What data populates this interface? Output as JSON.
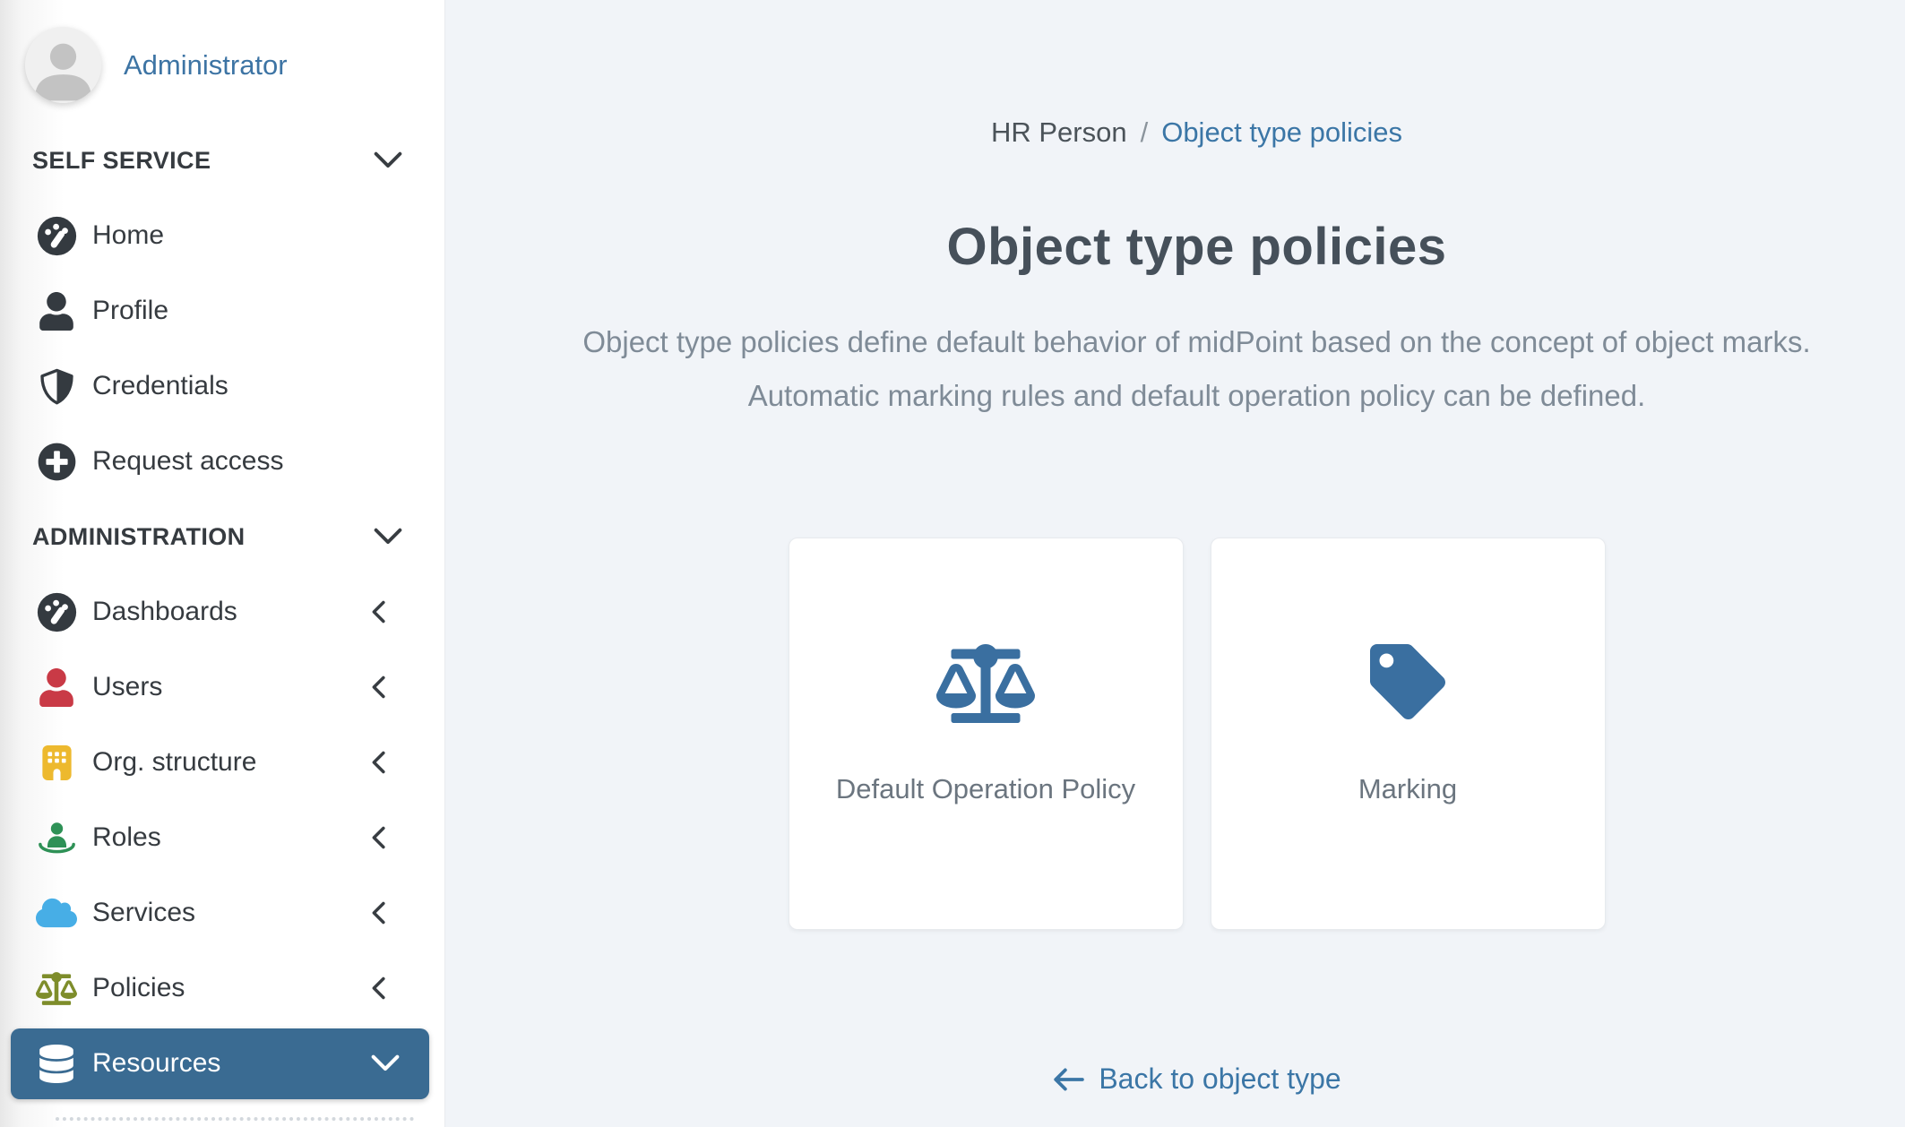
{
  "sidebar": {
    "user": {
      "name": "Administrator"
    },
    "sections": [
      {
        "label": "SELF SERVICE",
        "chevron": "down",
        "items": [
          {
            "label": "Home",
            "icon": "gauge-icon"
          },
          {
            "label": "Profile",
            "icon": "user-icon"
          },
          {
            "label": "Credentials",
            "icon": "shield-icon"
          },
          {
            "label": "Request access",
            "icon": "plus-circle-icon"
          }
        ]
      },
      {
        "label": "ADMINISTRATION",
        "chevron": "down",
        "items": [
          {
            "label": "Dashboards",
            "icon": "gauge-icon",
            "chevron": "left"
          },
          {
            "label": "Users",
            "icon": "user-icon",
            "chevron": "left"
          },
          {
            "label": "Org. structure",
            "icon": "building-icon",
            "chevron": "left"
          },
          {
            "label": "Roles",
            "icon": "person-ring-icon",
            "chevron": "left"
          },
          {
            "label": "Services",
            "icon": "cloud-icon",
            "chevron": "left"
          },
          {
            "label": "Policies",
            "icon": "balance-scale-icon",
            "chevron": "left"
          },
          {
            "label": "Resources",
            "icon": "database-icon",
            "chevron": "down",
            "selected": true
          }
        ]
      }
    ]
  },
  "main": {
    "breadcrumb": {
      "parent": "HR Person",
      "separator": "/",
      "current": "Object type policies"
    },
    "title": "Object type policies",
    "description": "Object type policies define default behavior of midPoint based on the concept of object marks. Automatic marking rules and default operation policy can be defined.",
    "cards": [
      {
        "label": "Default Operation Policy",
        "icon": "balance-scale-icon"
      },
      {
        "label": "Marking",
        "icon": "tag-icon"
      }
    ],
    "back_link": {
      "label": "Back to object type",
      "icon": "arrow-left-icon"
    }
  },
  "colors": {
    "accent_link": "#3b76a6",
    "selected_item_bg": "#3a6b92",
    "card_icon_blue": "#3a6fa0",
    "icon_dark": "#343a40",
    "users_icon_red": "#c93a46",
    "org_icon_yellow": "#edb92e",
    "roles_icon_green": "#2e9156",
    "services_icon_blue": "#47aee6",
    "policies_icon_olive": "#7e8d2b",
    "title_text": "#46505a",
    "description_text": "#7f8b97",
    "main_bg": "#f1f4f8"
  }
}
